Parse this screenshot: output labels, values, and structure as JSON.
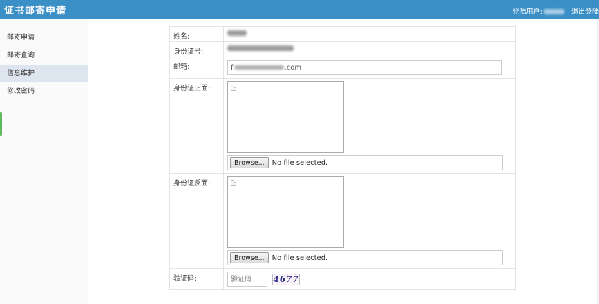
{
  "header": {
    "app_title": "证书邮寄申请",
    "user_label": "登陆用户:",
    "logout": "退出登陆"
  },
  "sidebar": {
    "items": [
      {
        "label": "邮寄申请",
        "active": false
      },
      {
        "label": "邮寄查询",
        "active": false
      },
      {
        "label": "信息维护",
        "active": true
      },
      {
        "label": "修改密码",
        "active": false
      }
    ]
  },
  "form": {
    "name_label": "姓名:",
    "id_label": "身份证号:",
    "email_label": "邮箱:",
    "email_prefix": "f",
    "email_suffix": ".com",
    "id_front_label": "身份证正面:",
    "id_back_label": "身份证反面:",
    "browse_label": "Browse...",
    "no_file_text": "No file selected.",
    "captcha_label": "验证码:",
    "captcha_placeholder": "验证码",
    "captcha_code": "4677"
  },
  "colors": {
    "header_bg": "#3a8fc6",
    "active_nav_bg": "#dde5ee",
    "side_tab": "#5cb85c"
  },
  "icons": {
    "broken_image": "broken-image-icon",
    "side_tab": "green-side-tab"
  }
}
